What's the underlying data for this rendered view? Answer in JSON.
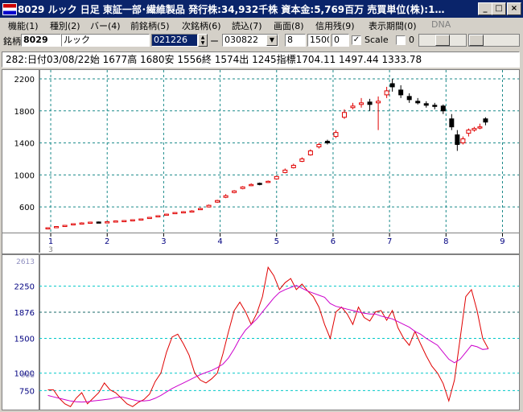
{
  "window": {
    "title": "8029 ルック  日足  東証一部･繊維製品  発行株:34,932千株  資本金:5,769百万  売買単位(株):1…",
    "buttons": {
      "minimize": "_",
      "maximize": "□",
      "close": "×"
    }
  },
  "menu": [
    {
      "label": "機能(1)",
      "enabled": true
    },
    {
      "label": "種別(2)",
      "enabled": true
    },
    {
      "label": "バー(4)",
      "enabled": true
    },
    {
      "label": "前銘柄(5)",
      "enabled": true
    },
    {
      "label": "次銘柄(6)",
      "enabled": true
    },
    {
      "label": "読込(7)",
      "enabled": true
    },
    {
      "label": "画面(8)",
      "enabled": true
    },
    {
      "label": "信用残(9)",
      "enabled": true
    },
    {
      "label": "表示期間(0)",
      "enabled": true
    },
    {
      "label": "DNA",
      "enabled": false
    }
  ],
  "toolbar": {
    "stock_label": "銘柄",
    "stock_code": "8029",
    "stock_name": "ルック",
    "start_date": "021226",
    "dash": "ー",
    "end_date": "030822",
    "field_a": "8",
    "field_b": "1500",
    "field_c": "0",
    "scale_checked": true,
    "scale_label": "Scale",
    "field_d": "0"
  },
  "info_line": "282:日付03/08/22始 1677高 1680安 1556終 1574出 1245指標1704.11   1497.44   1333.78",
  "colors": {
    "up_candle": "#e00000",
    "down_candle": "#000000",
    "indicator_line": "#e00000",
    "signal_line": "#cc00cc",
    "grid": "#1a8a8a",
    "grid_lower": "#00c8c8"
  },
  "chart_data": [
    {
      "type": "candlestick",
      "ylim": [
        300,
        2250
      ],
      "y_ticks": [
        "600",
        "1000",
        "1400",
        "1800",
        "2200"
      ],
      "x_ticks": [
        "1",
        "2",
        "3",
        "4",
        "5",
        "6",
        "7",
        "8",
        "9"
      ],
      "x_range": [
        0.8,
        9.05
      ],
      "x": [
        0.95,
        1.1,
        1.25,
        1.4,
        1.55,
        1.7,
        1.85,
        2.0,
        2.15,
        2.3,
        2.45,
        2.6,
        2.75,
        2.9,
        3.05,
        3.2,
        3.35,
        3.5,
        3.65,
        3.8,
        3.95,
        4.1,
        4.25,
        4.4,
        4.55,
        4.7,
        4.85,
        5.0,
        5.15,
        5.3,
        5.45,
        5.6,
        5.75,
        5.9,
        6.05,
        6.2,
        6.35,
        6.5,
        6.65,
        6.8,
        6.95,
        7.05,
        7.2,
        7.35,
        7.5,
        7.65,
        7.8,
        7.95,
        8.1,
        8.2,
        8.3,
        8.4,
        8.5,
        8.6,
        8.7
      ],
      "close": [
        340,
        355,
        370,
        390,
        400,
        410,
        405,
        415,
        425,
        430,
        440,
        450,
        470,
        490,
        510,
        530,
        540,
        550,
        580,
        620,
        680,
        740,
        800,
        850,
        880,
        890,
        920,
        980,
        1060,
        1120,
        1200,
        1300,
        1380,
        1400,
        1530,
        1780,
        1860,
        1900,
        1880,
        1920,
        2050,
        2100,
        2000,
        1940,
        1900,
        1870,
        1860,
        1800,
        1600,
        1380,
        1450,
        1560,
        1580,
        1600,
        1660
      ],
      "open": [
        330,
        345,
        360,
        375,
        395,
        400,
        412,
        410,
        420,
        426,
        435,
        445,
        460,
        480,
        500,
        520,
        535,
        548,
        570,
        600,
        660,
        720,
        780,
        830,
        870,
        895,
        910,
        950,
        1030,
        1090,
        1170,
        1250,
        1350,
        1420,
        1480,
        1720,
        1840,
        1880,
        1910,
        1900,
        2000,
        2140,
        2060,
        1980,
        1920,
        1890,
        1870,
        1860,
        1700,
        1500,
        1400,
        1520,
        1560,
        1590,
        1700
      ],
      "high": [
        345,
        360,
        375,
        395,
        408,
        415,
        418,
        420,
        430,
        435,
        445,
        455,
        475,
        495,
        515,
        535,
        548,
        560,
        590,
        630,
        690,
        760,
        810,
        860,
        895,
        905,
        930,
        990,
        1080,
        1140,
        1220,
        1320,
        1400,
        1440,
        1560,
        1820,
        1900,
        1960,
        1950,
        1980,
        2100,
        2200,
        2120,
        2020,
        1960,
        1920,
        1900,
        1880,
        1760,
        1560,
        1480,
        1580,
        1600,
        1640,
        1720
      ],
      "low": [
        325,
        340,
        355,
        370,
        390,
        395,
        400,
        405,
        415,
        420,
        430,
        440,
        455,
        475,
        495,
        515,
        530,
        540,
        565,
        595,
        650,
        710,
        770,
        820,
        860,
        870,
        900,
        940,
        1020,
        1080,
        1160,
        1240,
        1330,
        1380,
        1460,
        1700,
        1820,
        1840,
        1800,
        1560,
        1960,
        2040,
        1960,
        1900,
        1880,
        1840,
        1820,
        1760,
        1560,
        1300,
        1380,
        1480,
        1540,
        1570,
        1620
      ]
    },
    {
      "type": "line",
      "ylim": [
        500,
        2650
      ],
      "y_ticks": [
        "750",
        "1000",
        "1500",
        "1876",
        "2250"
      ],
      "y_ticks_dim": [
        "988",
        "2613"
      ],
      "x_ticks": [
        "3"
      ],
      "x_range": [
        0.8,
        9.05
      ],
      "series": [
        {
          "x": [
            0.95,
            1.05,
            1.15,
            1.25,
            1.35,
            1.45,
            1.55,
            1.65,
            1.75,
            1.85,
            1.95,
            2.05,
            2.15,
            2.25,
            2.35,
            2.45,
            2.55,
            2.65,
            2.75,
            2.85,
            2.95,
            3.05,
            3.15,
            3.25,
            3.35,
            3.45,
            3.55,
            3.65,
            3.75,
            3.85,
            3.95,
            4.05,
            4.15,
            4.25,
            4.35,
            4.45,
            4.55,
            4.65,
            4.75,
            4.85,
            4.95,
            5.05,
            5.15,
            5.25,
            5.35,
            5.45,
            5.55,
            5.65,
            5.75,
            5.85,
            5.95,
            6.05,
            6.15,
            6.25,
            6.35,
            6.45,
            6.55,
            6.65,
            6.75,
            6.85,
            6.95,
            7.05,
            7.15,
            7.25,
            7.35,
            7.45,
            7.55,
            7.65,
            7.75,
            7.85,
            7.95,
            8.05,
            8.15,
            8.25,
            8.35,
            8.45,
            8.55,
            8.65,
            8.75
          ],
          "values": [
            760,
            760,
            640,
            560,
            520,
            640,
            720,
            560,
            640,
            720,
            860,
            760,
            720,
            640,
            560,
            520,
            580,
            620,
            700,
            880,
            1000,
            1300,
            1520,
            1560,
            1420,
            1260,
            1000,
            900,
            860,
            920,
            1000,
            1280,
            1600,
            1900,
            2020,
            1880,
            1700,
            1860,
            2100,
            2520,
            2400,
            2200,
            2300,
            2360,
            2200,
            2280,
            2180,
            2100,
            1950,
            1700,
            1500,
            1880,
            1950,
            1850,
            1700,
            1950,
            1800,
            1750,
            1880,
            1900,
            1760,
            1900,
            1650,
            1500,
            1400,
            1600,
            1420,
            1250,
            1100,
            1000,
            850,
            600,
            900,
            1500,
            2100,
            2200,
            1900,
            1500,
            1350
          ]
        },
        {
          "x": [
            0.95,
            1.05,
            1.15,
            1.25,
            1.35,
            1.45,
            1.55,
            1.65,
            1.75,
            1.85,
            1.95,
            2.05,
            2.15,
            2.25,
            2.35,
            2.45,
            2.55,
            2.65,
            2.75,
            2.85,
            2.95,
            3.05,
            3.15,
            3.25,
            3.35,
            3.45,
            3.55,
            3.65,
            3.75,
            3.85,
            3.95,
            4.05,
            4.15,
            4.25,
            4.35,
            4.45,
            4.55,
            4.65,
            4.75,
            4.85,
            4.95,
            5.05,
            5.15,
            5.25,
            5.35,
            5.45,
            5.55,
            5.65,
            5.75,
            5.85,
            5.95,
            6.05,
            6.15,
            6.25,
            6.35,
            6.45,
            6.55,
            6.65,
            6.75,
            6.85,
            6.95,
            7.05,
            7.15,
            7.25,
            7.35,
            7.45,
            7.55,
            7.65,
            7.75,
            7.85,
            7.95,
            8.05,
            8.15,
            8.25,
            8.35,
            8.45,
            8.55,
            8.65,
            8.75
          ],
          "values": [
            680,
            660,
            640,
            620,
            600,
            590,
            585,
            590,
            600,
            610,
            620,
            630,
            650,
            660,
            640,
            620,
            600,
            600,
            610,
            640,
            680,
            730,
            780,
            820,
            860,
            900,
            940,
            980,
            1010,
            1040,
            1080,
            1130,
            1220,
            1350,
            1500,
            1620,
            1700,
            1780,
            1880,
            1980,
            2080,
            2160,
            2200,
            2230,
            2260,
            2220,
            2180,
            2150,
            2120,
            2090,
            2000,
            1960,
            1940,
            1920,
            1900,
            1880,
            1860,
            1850,
            1850,
            1820,
            1800,
            1780,
            1740,
            1700,
            1660,
            1600,
            1560,
            1500,
            1450,
            1400,
            1300,
            1200,
            1150,
            1200,
            1300,
            1400,
            1380,
            1340,
            1350
          ]
        }
      ]
    }
  ]
}
